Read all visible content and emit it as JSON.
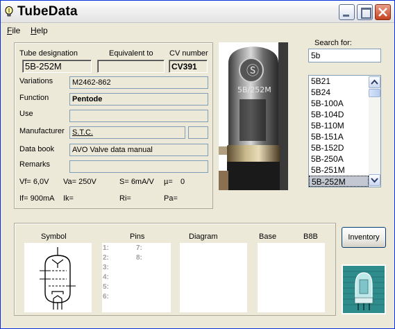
{
  "window": {
    "title": "TubeData"
  },
  "menu": [
    {
      "label": "File"
    },
    {
      "label": "Help"
    }
  ],
  "main": {
    "tube_designation_label": "Tube designation",
    "tube_designation": "5B-252M",
    "equivalent_label": "Equivalent to",
    "equivalent": "",
    "cv_label": "CV number",
    "cv": "CV391",
    "variations_label": "Variations",
    "variations": "M2462-862",
    "function_label": "Function",
    "function": "Pentode",
    "use_label": "Use",
    "use": "",
    "manufacturer_label": "Manufacturer",
    "manufacturer": "S.T.C.",
    "manufacturer_extra": "",
    "databook_label": "Data book",
    "databook": "AVO Valve data manual",
    "remarks_label": "Remarks",
    "remarks": ""
  },
  "stats": {
    "vf": "Vf= 6,0V",
    "va": "Va= 250V",
    "s": "S= 6mA/V",
    "mu": "µ=",
    "mu_val": "0",
    "if": "If= 900mA",
    "ik": "Ik=",
    "ri": "Ri=",
    "pa": "Pa="
  },
  "search": {
    "label": "Search for:",
    "value": "5b",
    "results": [
      "5B21",
      "5B24",
      "5B-100A",
      "5B-104D",
      "5B-110M",
      "5B-151A",
      "5B-152D",
      "5B-250A",
      "5B-251M",
      "5B-252M"
    ],
    "selected": "5B-252M"
  },
  "bottom": {
    "symbol_label": "Symbol",
    "pins_label": "Pins",
    "diagram_label": "Diagram",
    "base_label": "Base",
    "base_value": "B8B",
    "pins_left": [
      "1:",
      "2:",
      "3:",
      "4:",
      "5:",
      "6:"
    ],
    "pins_right": [
      "7:",
      "8:"
    ]
  },
  "buttons": {
    "inventory": "Inventory"
  },
  "photo": {
    "tube_marking": "5B/252M"
  }
}
